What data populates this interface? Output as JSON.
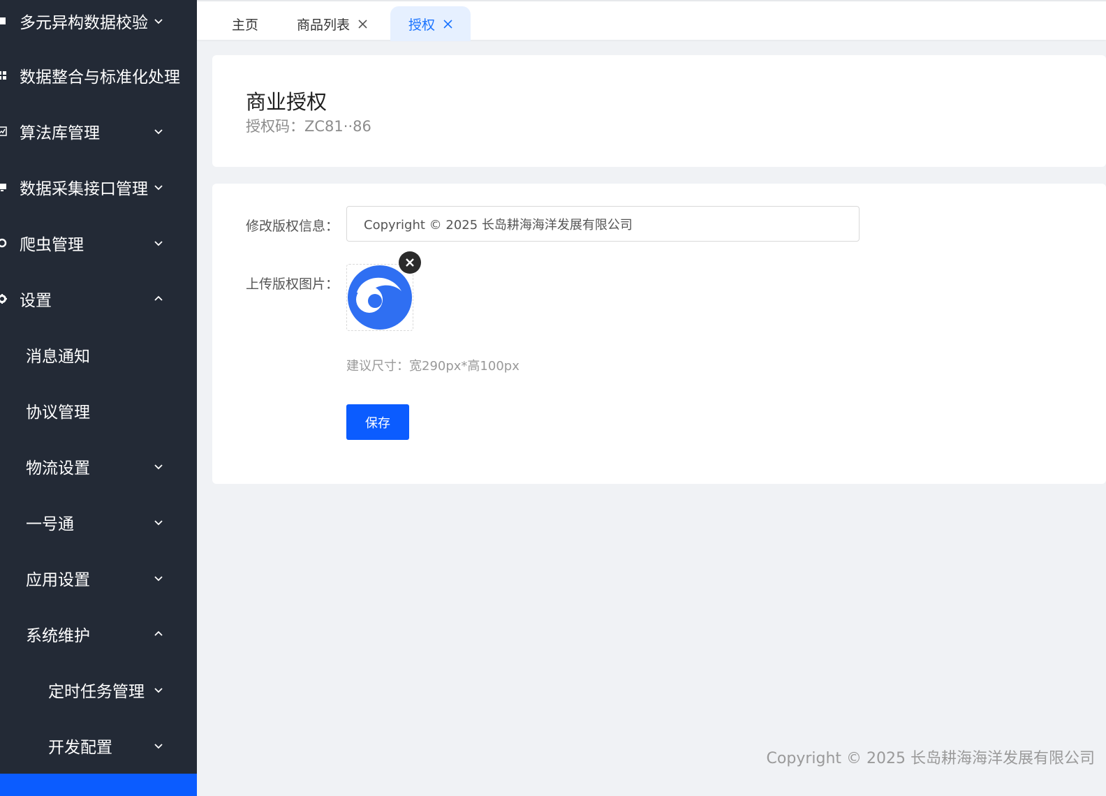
{
  "sidebar": {
    "items": [
      {
        "label": "多元异构数据校验",
        "icon": "flag-icon",
        "arrow": "down"
      },
      {
        "label": "数据整合与标准化处理",
        "icon": "grid-icon",
        "arrow": ""
      },
      {
        "label": "算法库管理",
        "icon": "chart-icon",
        "arrow": "down"
      },
      {
        "label": "数据采集接口管理",
        "icon": "monitor-icon",
        "arrow": "down"
      },
      {
        "label": "爬虫管理",
        "icon": "spider-icon",
        "arrow": "down"
      },
      {
        "label": "设置",
        "icon": "gear-icon",
        "arrow": "up"
      },
      {
        "label": "消息通知",
        "icon": "",
        "arrow": ""
      },
      {
        "label": "协议管理",
        "icon": "",
        "arrow": ""
      },
      {
        "label": "物流设置",
        "icon": "",
        "arrow": "down"
      },
      {
        "label": "一号通",
        "icon": "",
        "arrow": "down"
      },
      {
        "label": "应用设置",
        "icon": "",
        "arrow": "down"
      },
      {
        "label": "系统维护",
        "icon": "",
        "arrow": "up"
      },
      {
        "label": "定时任务管理",
        "icon": "",
        "arrow": "down"
      },
      {
        "label": "开发配置",
        "icon": "",
        "arrow": "down"
      }
    ]
  },
  "tabs": [
    {
      "label": "主页",
      "closable": false
    },
    {
      "label": "商品列表",
      "closable": true
    },
    {
      "label": "授权",
      "closable": true,
      "active": true
    }
  ],
  "license": {
    "title": "商业授权",
    "code_label": "授权码：",
    "code_value": "ZC81··86"
  },
  "form": {
    "copyright_label": "修改版权信息：",
    "copyright_value": "Copyright © 2025 长岛耕海海洋发展有限公司",
    "image_label": "上传版权图片：",
    "hint": "建议尺寸：宽290px*高100px",
    "save_label": "保存"
  },
  "footer": {
    "text": "Copyright © 2025 长岛耕海海洋发展有限公司"
  },
  "colors": {
    "sidebar_bg": "#232a36",
    "accent": "#0b5cff",
    "tab_active_bg": "#e6f0ff",
    "logo_blue": "#2f6ff2"
  }
}
